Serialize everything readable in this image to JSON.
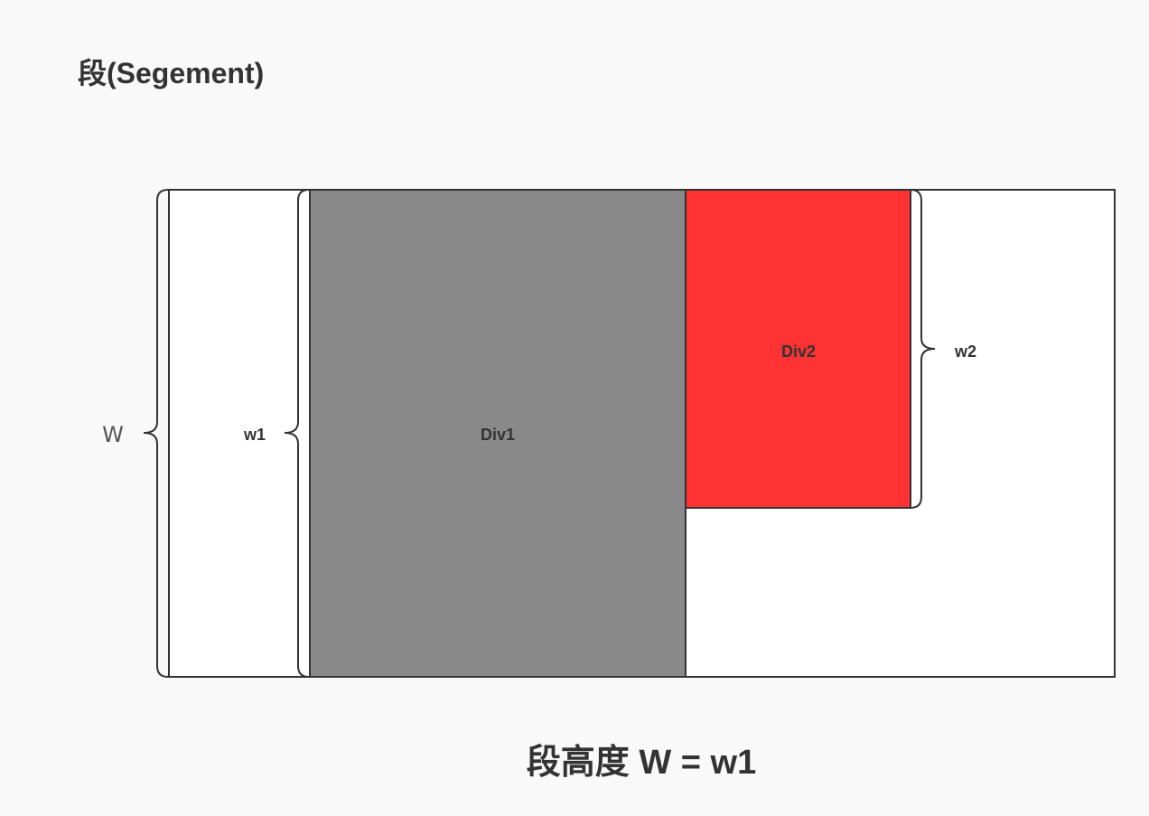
{
  "title": "段(Segement)",
  "formula": "段高度 W = w1",
  "blocks": {
    "div1": {
      "label": "Div1",
      "color": "#898989"
    },
    "div2": {
      "label": "Div2",
      "color": "#ff3333"
    }
  },
  "braces": {
    "W": {
      "label": "W"
    },
    "w1": {
      "label": "w1"
    },
    "w2": {
      "label": "w2"
    }
  },
  "colors": {
    "background": "#f9f9f9",
    "container": "#ffffff",
    "stroke": "#333333"
  }
}
